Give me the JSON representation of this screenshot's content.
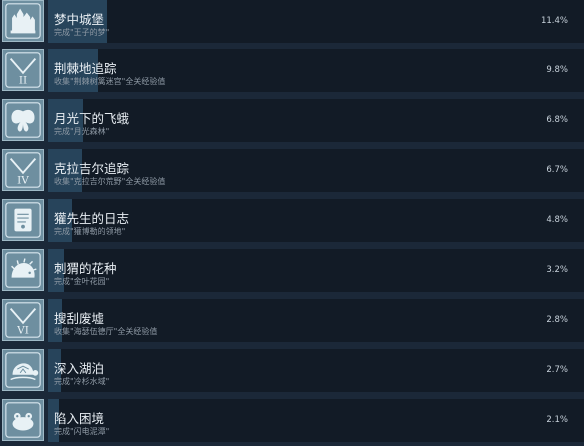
{
  "achievements": [
    {
      "title": "梦中城堡",
      "description": "完成\"王子的梦\"",
      "percent_label": "11.4%",
      "percent": 11.4,
      "icon": "castle-icon"
    },
    {
      "title": "荆棘地追踪",
      "description": "收集\"荆棘树篱迷宫\"全关经验值",
      "percent_label": "9.8%",
      "percent": 9.8,
      "icon": "roman-numeral-ii-icon"
    },
    {
      "title": "月光下的飞蛾",
      "description": "完成\"月光森林\"",
      "percent_label": "6.8%",
      "percent": 6.8,
      "icon": "moth-icon"
    },
    {
      "title": "克拉吉尔追踪",
      "description": "收集\"克拉吉尔荒野\"全关经验值",
      "percent_label": "6.7%",
      "percent": 6.7,
      "icon": "roman-numeral-iv-icon"
    },
    {
      "title": "獾先生的日志",
      "description": "完成\"獾博勒的领地\"",
      "percent_label": "4.8%",
      "percent": 4.8,
      "icon": "journal-icon"
    },
    {
      "title": "刺猬的花种",
      "description": "完成\"金叶花园\"",
      "percent_label": "3.2%",
      "percent": 3.2,
      "icon": "hedgehog-icon"
    },
    {
      "title": "搜刮废墟",
      "description": "收集\"海瑟伍德厅\"全关经验值",
      "percent_label": "2.8%",
      "percent": 2.8,
      "icon": "roman-numeral-vi-icon"
    },
    {
      "title": "深入湖泊",
      "description": "完成\"冷杉水域\"",
      "percent_label": "2.7%",
      "percent": 2.7,
      "icon": "turtle-icon"
    },
    {
      "title": "陷入困境",
      "description": "完成\"闪电泥潭\"",
      "percent_label": "2.1%",
      "percent": 2.1,
      "icon": "frog-icon"
    }
  ]
}
